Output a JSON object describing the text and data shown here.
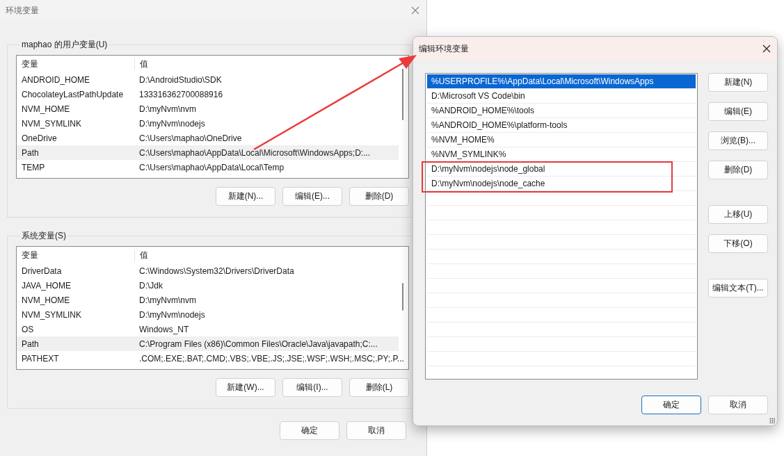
{
  "main_window": {
    "title": "环境变量",
    "user_vars": {
      "label": "maphao 的用户变量(U)",
      "columns": [
        "变量",
        "值"
      ],
      "rows": [
        {
          "name": "ANDROID_HOME",
          "value": "D:\\AndroidStudio\\SDK",
          "selected": false
        },
        {
          "name": "ChocolateyLastPathUpdate",
          "value": "133316362700088916",
          "selected": false
        },
        {
          "name": "NVM_HOME",
          "value": "D:\\myNvm\\nvm",
          "selected": false
        },
        {
          "name": "NVM_SYMLINK",
          "value": "D:\\myNvm\\nodejs",
          "selected": false
        },
        {
          "name": "OneDrive",
          "value": "C:\\Users\\maphao\\OneDrive",
          "selected": false
        },
        {
          "name": "Path",
          "value": "C:\\Users\\maphao\\AppData\\Local\\Microsoft\\WindowsApps;D:...",
          "selected": true
        },
        {
          "name": "TEMP",
          "value": "C:\\Users\\maphao\\AppData\\Local\\Temp",
          "selected": false
        }
      ],
      "buttons": [
        "新建(N)...",
        "编辑(E)...",
        "删除(D)"
      ]
    },
    "system_vars": {
      "label": "系统变量(S)",
      "columns": [
        "变量",
        "值"
      ],
      "rows": [
        {
          "name": "DriverData",
          "value": "C:\\Windows\\System32\\Drivers\\DriverData",
          "selected": false
        },
        {
          "name": "JAVA_HOME",
          "value": "D:\\Jdk",
          "selected": false
        },
        {
          "name": "NVM_HOME",
          "value": "D:\\myNvm\\nvm",
          "selected": false
        },
        {
          "name": "NVM_SYMLINK",
          "value": "D:\\myNvm\\nodejs",
          "selected": false
        },
        {
          "name": "OS",
          "value": "Windows_NT",
          "selected": false
        },
        {
          "name": "Path",
          "value": "C:\\Program Files (x86)\\Common Files\\Oracle\\Java\\javapath;C:...",
          "selected": true
        },
        {
          "name": "PATHEXT",
          "value": ".COM;.EXE;.BAT;.CMD;.VBS;.VBE;.JS;.JSE;.WSF;.WSH;.MSC;.PY;.P...",
          "selected": false
        }
      ],
      "buttons": [
        "新建(W)...",
        "编辑(I)...",
        "删除(L)"
      ]
    },
    "buttons": [
      "确定",
      "取消"
    ]
  },
  "edit_dialog": {
    "title": "编辑环境变量",
    "entries": [
      {
        "text": "%USERPROFILE%\\AppData\\Local\\Microsoft\\WindowsApps",
        "selected": true
      },
      {
        "text": "D:\\Microsoft VS Code\\bin",
        "selected": false
      },
      {
        "text": "%ANDROID_HOME%\\tools",
        "selected": false
      },
      {
        "text": "%ANDROID_HOME%\\platform-tools",
        "selected": false
      },
      {
        "text": "%NVM_HOME%",
        "selected": false
      },
      {
        "text": "%NVM_SYMLINK%",
        "selected": false
      },
      {
        "text": "D:\\myNvm\\nodejs\\node_global",
        "selected": false
      },
      {
        "text": "D:\\myNvm\\nodejs\\node_cache",
        "selected": false
      }
    ],
    "side_button_groups": [
      [
        "新建(N)",
        "编辑(E)",
        "浏览(B)...",
        "删除(D)"
      ],
      [
        "上移(U)",
        "下移(O)"
      ],
      [
        "编辑文本(T)..."
      ]
    ],
    "buttons": [
      {
        "label": "确定",
        "default": true
      },
      {
        "label": "取消",
        "default": false
      }
    ]
  }
}
